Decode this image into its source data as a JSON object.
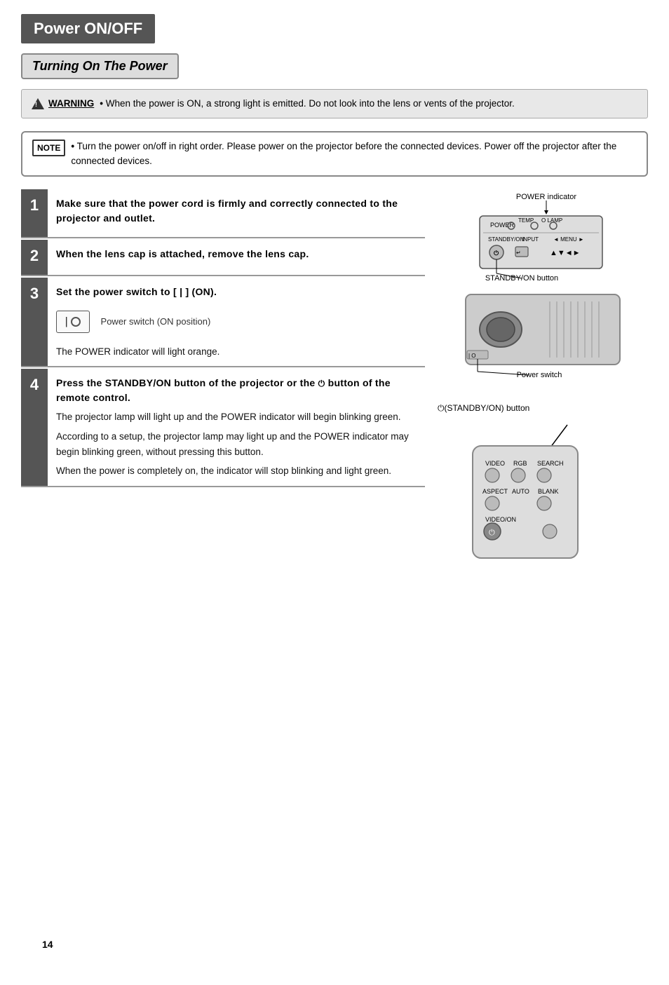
{
  "header": {
    "title": "Power ON/OFF"
  },
  "section": {
    "title": "Turning On The Power"
  },
  "warning": {
    "label": "WARNING",
    "text": "When the power is ON, a strong light is emitted. Do not look into the lens or vents of the projector."
  },
  "note": {
    "label": "NOTE",
    "text": "Turn the power on/off in right order. Please power on the projector before the connected devices. Power off the projector after the connected devices."
  },
  "steps": [
    {
      "number": "1",
      "title": "Make sure that the power cord is firmly and correctly connected to the projector and outlet.",
      "body": ""
    },
    {
      "number": "2",
      "title": "When the lens cap is attached, remove the lens cap.",
      "body": ""
    },
    {
      "number": "3",
      "title": "Set the power switch to [ | ] (ON).",
      "switch_label": "Power switch (ON position)",
      "body": "The POWER indicator will light orange."
    },
    {
      "number": "4",
      "title": "Press the STANDBY/ON button of the projector or the ⏻ button of the remote control.",
      "body_lines": [
        "The projector lamp will light up and the POWER indicator will begin blinking green.",
        "According to a setup, the projector lamp may light up and the POWER indicator may begin blinking green, without pressing this button.",
        "When the power is completely on, the indicator will stop blinking and light green."
      ]
    }
  ],
  "diagrams": {
    "projector_labels": {
      "power_indicator": "POWER indicator",
      "standby_on_button": "STANDBY/ON button",
      "power_switch": "Power switch",
      "temp": "TEMP",
      "lamp": "LAMP",
      "standby_on": "STANDBY/ON",
      "input": "INPUT",
      "menu": "MENU"
    },
    "remote_labels": {
      "standby_label": "⏻(STANDBY/ON) button",
      "video": "VIDEO",
      "rgb": "RGB",
      "search": "SEARCH",
      "aspect": "ASPECT",
      "auto": "AUTO",
      "blank": "BLANK"
    }
  },
  "page_number": "14"
}
